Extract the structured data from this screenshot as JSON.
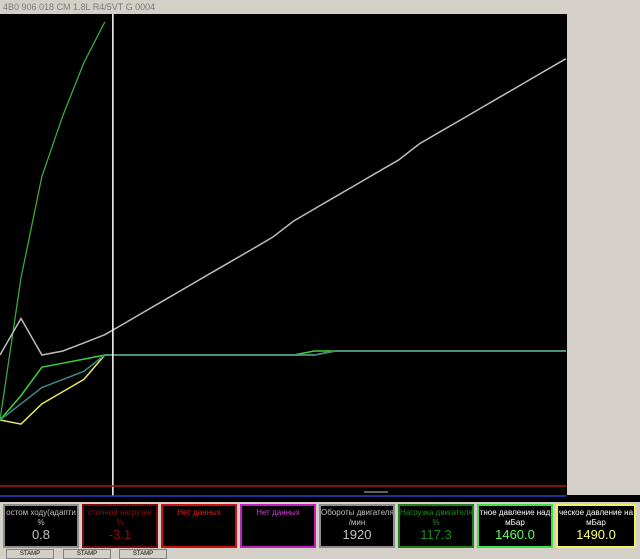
{
  "window": {
    "title": "4B0 906 018 CM  1.8L R4/5VT     G   0004"
  },
  "chart_data": {
    "type": "line",
    "cursor_sample": 4,
    "series": [
      {
        "color": "#3aa83a",
        "values": [
          0.0,
          0.35,
          0.6,
          0.75,
          0.88,
          0.98
        ]
      },
      {
        "color": "#bdbdbd",
        "values": [
          0.16,
          0.25,
          0.16,
          0.17,
          0.19,
          0.21,
          0.24,
          0.27,
          0.3,
          0.33,
          0.36,
          0.39,
          0.42,
          0.45,
          0.49,
          0.52,
          0.55,
          0.58,
          0.61,
          0.64,
          0.68,
          0.71,
          0.74,
          0.77,
          0.8,
          0.83,
          0.86,
          0.89
        ]
      },
      {
        "color": "#3ad33a",
        "values": [
          0.0,
          0.06,
          0.13,
          0.14,
          0.15,
          0.16,
          0.16,
          0.16,
          0.16,
          0.16,
          0.16,
          0.16,
          0.16,
          0.16,
          0.16,
          0.17,
          0.17,
          0.17,
          0.17,
          0.17,
          0.17,
          0.17,
          0.17,
          0.17,
          0.17,
          0.17,
          0.17,
          0.17
        ]
      },
      {
        "color": "#e8e85a",
        "values": [
          0.0,
          -0.01,
          0.04,
          0.07,
          0.1,
          0.16,
          0.16,
          0.16,
          0.16,
          0.16,
          0.16,
          0.16,
          0.16,
          0.16,
          0.16,
          0.16,
          0.17,
          0.17,
          0.17,
          0.17,
          0.17,
          0.17,
          0.17,
          0.17,
          0.17,
          0.17,
          0.17,
          0.17
        ]
      },
      {
        "color": "#3a8a8a",
        "values": [
          0.0,
          0.04,
          0.08,
          0.1,
          0.12,
          0.16,
          0.16,
          0.16,
          0.16,
          0.16,
          0.16,
          0.16,
          0.16,
          0.16,
          0.16,
          0.16,
          0.17,
          0.17,
          0.17,
          0.17,
          0.17,
          0.17,
          0.17,
          0.17,
          0.17,
          0.17,
          0.17,
          0.17
        ]
      }
    ]
  },
  "gauges": [
    {
      "title": "остом ходу(адапти",
      "unit": "%",
      "value": "0.8",
      "border": "#8c8c8c",
      "title_color": "#c0c0c0",
      "value_color": "#c0c0c0"
    },
    {
      "title": "стичной нагрузке",
      "unit": "%",
      "value": "-3.1",
      "border": "#7a0a0a",
      "title_color": "#8a1010",
      "value_color": "#8a1010"
    },
    {
      "title": "Нет данных",
      "unit": "",
      "value": "",
      "border": "#d01010",
      "title_color": "#e02020",
      "value_color": "#e02020"
    },
    {
      "title": "Нет данных",
      "unit": "",
      "value": "",
      "border": "#c020c0",
      "title_color": "#d040d0",
      "value_color": "#d040d0"
    },
    {
      "title": "Обороты двигателя",
      "unit": "/мин",
      "value": "1920",
      "border": "#8c8c8c",
      "title_color": "#c0c0c0",
      "value_color": "#c0c0c0"
    },
    {
      "title": "Нагрузка двигателя",
      "unit": "%",
      "value": "117.3",
      "border": "#208020",
      "title_color": "#1e8a1e",
      "value_color": "#1e8a1e"
    },
    {
      "title": "тное давление над",
      "unit": "мБар",
      "value": "1460.0",
      "border": "#40e040",
      "title_color": "#ffffff",
      "value_color": "#60ff60"
    },
    {
      "title": "ческое давление на",
      "unit": "мБар",
      "value": "1490.0",
      "border": "#f0f060",
      "title_color": "#ffffff",
      "value_color": "#ffff70"
    }
  ],
  "stamps": [
    "STAMP",
    "STAMP",
    "STAMP"
  ]
}
